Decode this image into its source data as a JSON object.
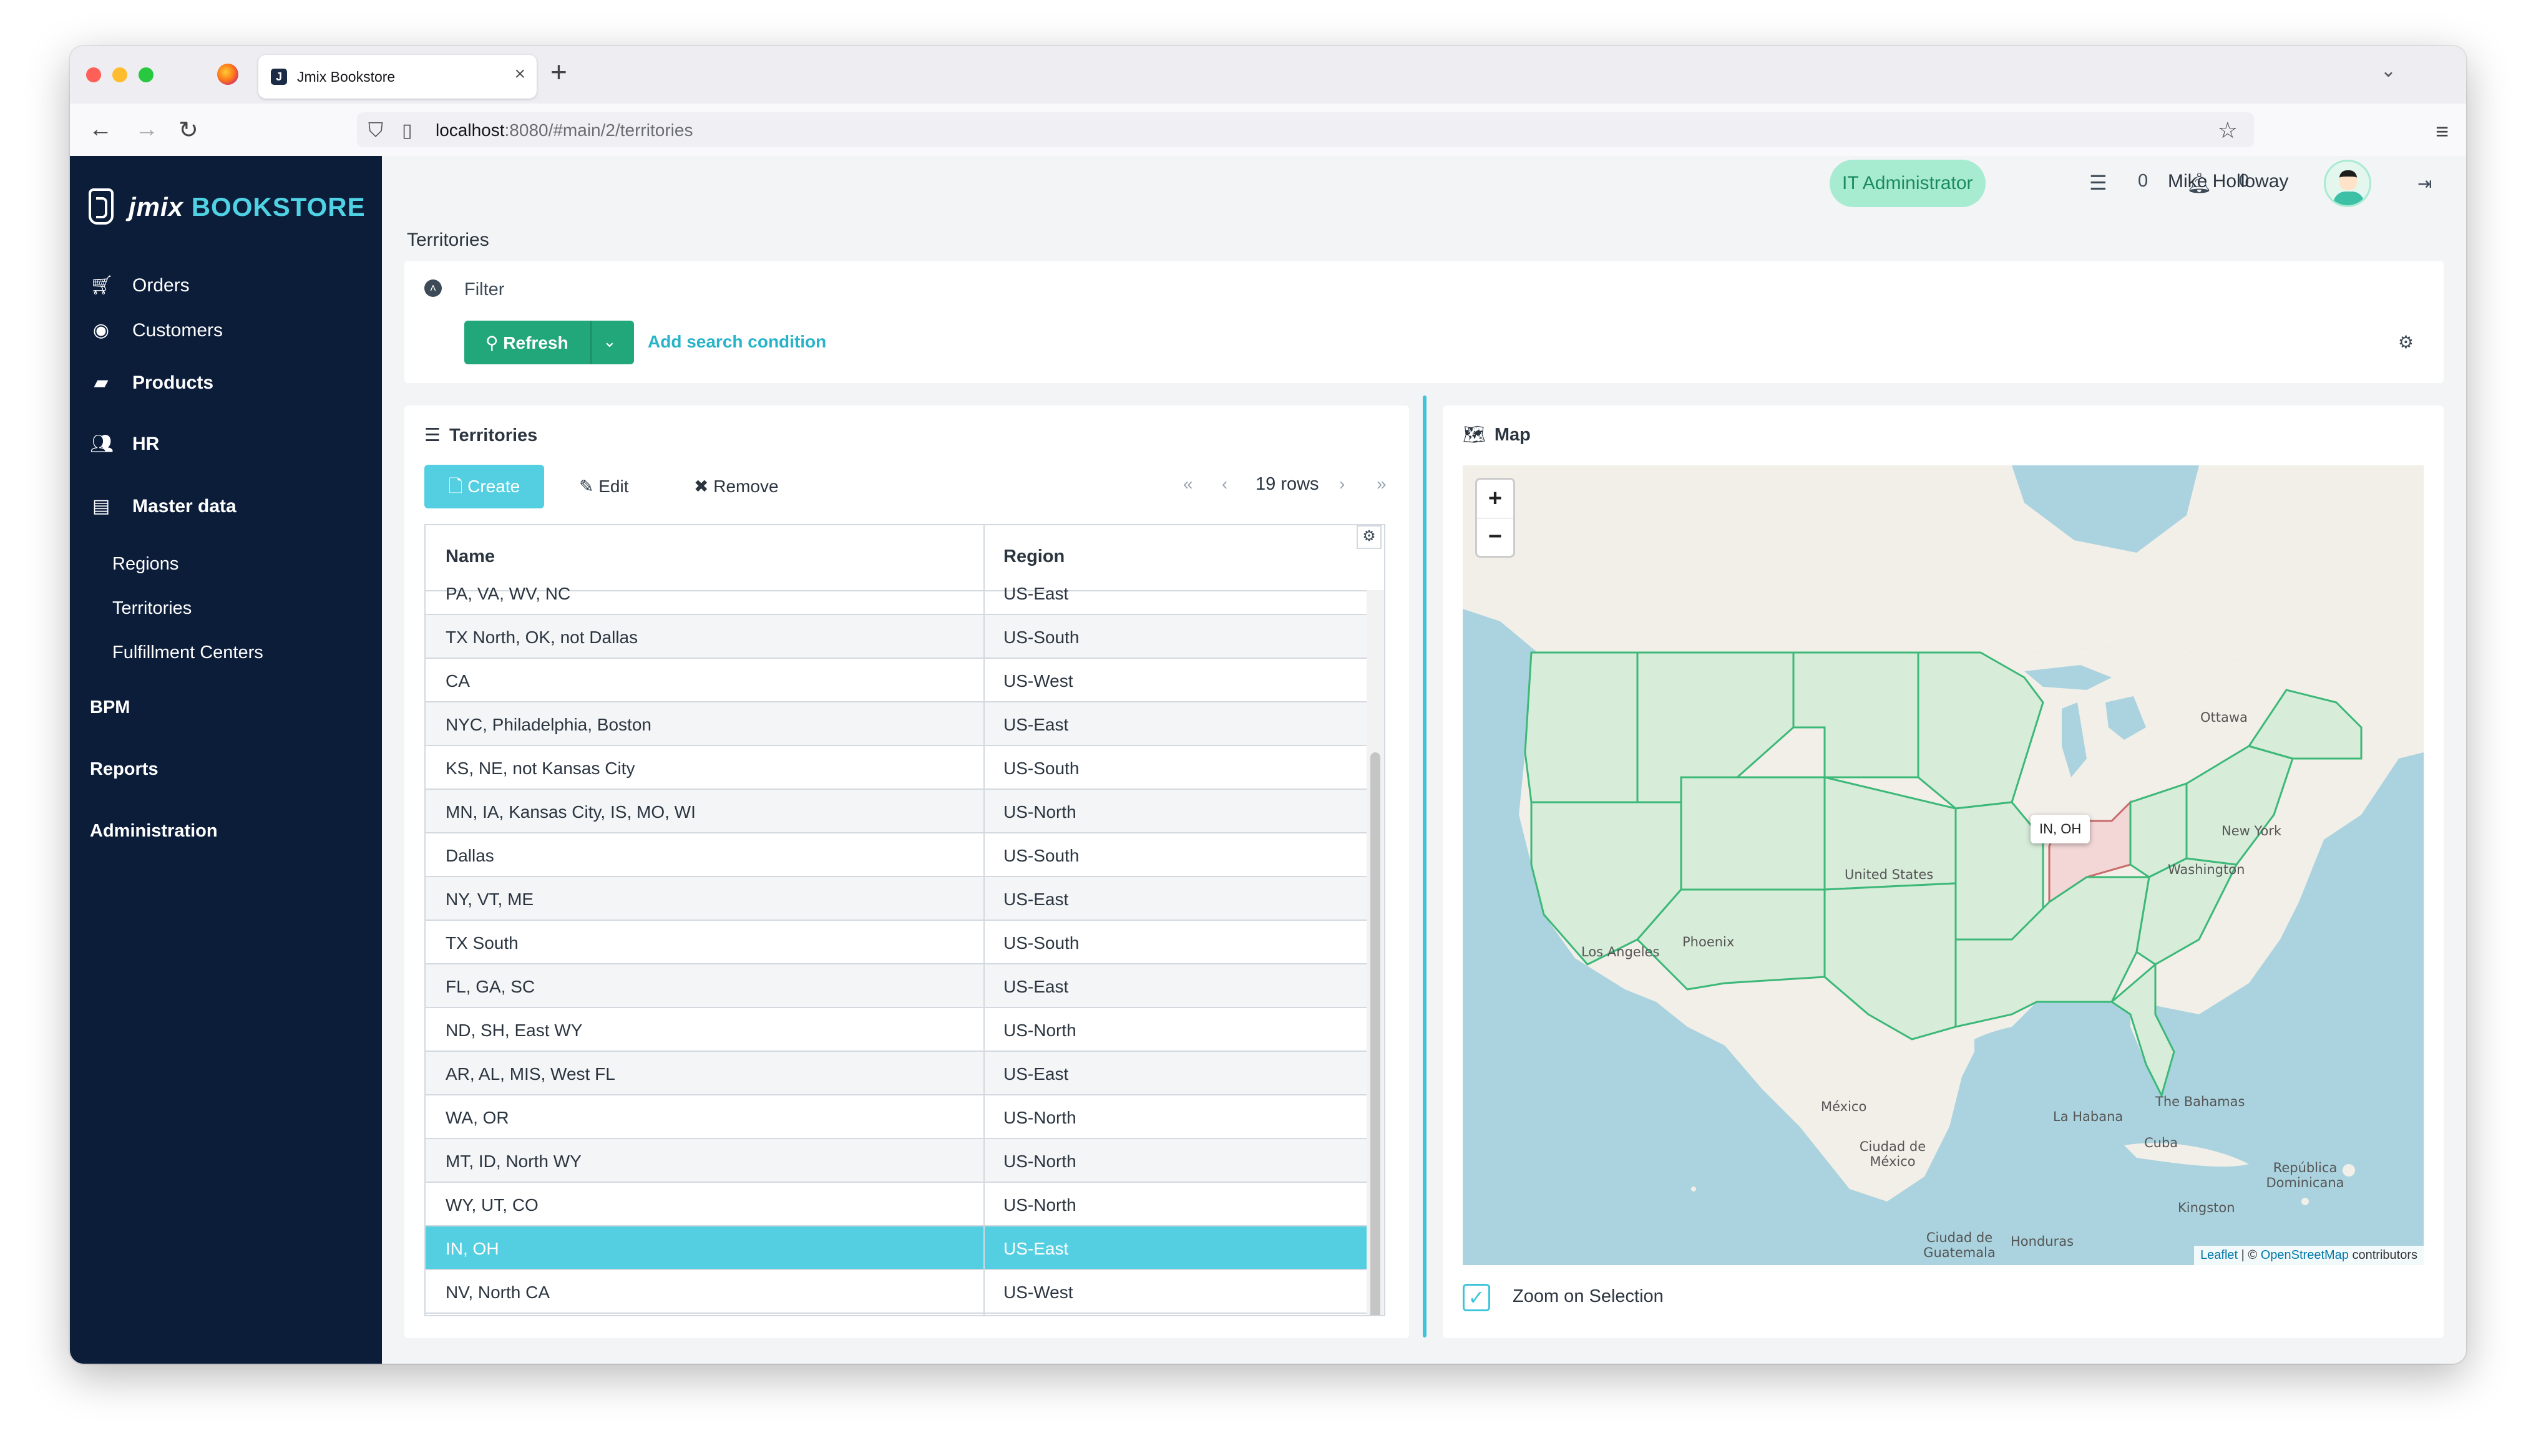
{
  "browser": {
    "tab_title": "Jmix Bookstore",
    "url_host": "localhost",
    "url_rest": ":8080/#main/2/territories"
  },
  "sidebar": {
    "logo_jmix": "jmix",
    "logo_bookstore": "BOOKSTORE",
    "items": [
      {
        "label": "Orders",
        "icon": "cart-icon"
      },
      {
        "label": "Customers",
        "icon": "user-circle-icon"
      },
      {
        "label": "Products",
        "icon": "book-icon"
      },
      {
        "label": "HR",
        "icon": "users-icon"
      },
      {
        "label": "Master data",
        "icon": "table-icon"
      }
    ],
    "sub_items": [
      "Regions",
      "Territories",
      "Fulfillment Centers"
    ],
    "groups": [
      "BPM",
      "Reports",
      "Administration"
    ]
  },
  "topbar": {
    "role": "IT Administrator",
    "tasks_count": "0",
    "notifications_count": "0",
    "user_name": "Mike Holloway"
  },
  "page": {
    "title": "Territories"
  },
  "filter": {
    "label": "Filter",
    "refresh_label": "Refresh",
    "add_condition_label": "Add search condition"
  },
  "territories": {
    "title": "Territories",
    "create_label": "Create",
    "edit_label": "Edit",
    "remove_label": "Remove",
    "rows_count": "19 rows",
    "columns": {
      "name": "Name",
      "region": "Region"
    },
    "rows": [
      {
        "name": "PA, VA, WV, NC",
        "region": "US-East"
      },
      {
        "name": "TX North, OK, not Dallas",
        "region": "US-South"
      },
      {
        "name": "CA",
        "region": "US-West"
      },
      {
        "name": "NYC, Philadelphia, Boston",
        "region": "US-East"
      },
      {
        "name": "KS, NE, not Kansas City",
        "region": "US-South"
      },
      {
        "name": "MN, IA, Kansas City, IS, MO, WI",
        "region": "US-North"
      },
      {
        "name": "Dallas",
        "region": "US-South"
      },
      {
        "name": "NY, VT, ME",
        "region": "US-East"
      },
      {
        "name": "TX South",
        "region": "US-South"
      },
      {
        "name": "FL, GA, SC",
        "region": "US-East"
      },
      {
        "name": "ND, SH, East WY",
        "region": "US-North"
      },
      {
        "name": "AR, AL, MIS, West FL",
        "region": "US-East"
      },
      {
        "name": "WA, OR",
        "region": "US-North"
      },
      {
        "name": "MT, ID, North WY",
        "region": "US-North"
      },
      {
        "name": "WY, UT, CO",
        "region": "US-North"
      },
      {
        "name": "IN, OH",
        "region": "US-East",
        "selected": true
      },
      {
        "name": "NV, North CA",
        "region": "US-West"
      }
    ]
  },
  "map": {
    "title": "Map",
    "tooltip": "IN, OH",
    "labels": {
      "ottawa": "Ottawa",
      "new_york": "New York",
      "washington": "Washington",
      "united_states": "United States",
      "los_angeles": "Los Angeles",
      "phoenix": "Phoenix",
      "mexico": "México",
      "mexico_city": "Ciudad de México",
      "la_habana": "La Habana",
      "bahamas": "The Bahamas",
      "cuba": "Cuba",
      "dominicana": "República Dominicana",
      "kingston": "Kingston",
      "guatemala": "Ciudad de Guatemala",
      "honduras": "Honduras"
    },
    "attribution_leaflet": "Leaflet",
    "attribution_sep": " | © ",
    "attribution_osm": "OpenStreetMap",
    "attribution_tail": " contributors",
    "zoom_on_selection_label": "Zoom on Selection",
    "zoom_on_selection_checked": true
  }
}
